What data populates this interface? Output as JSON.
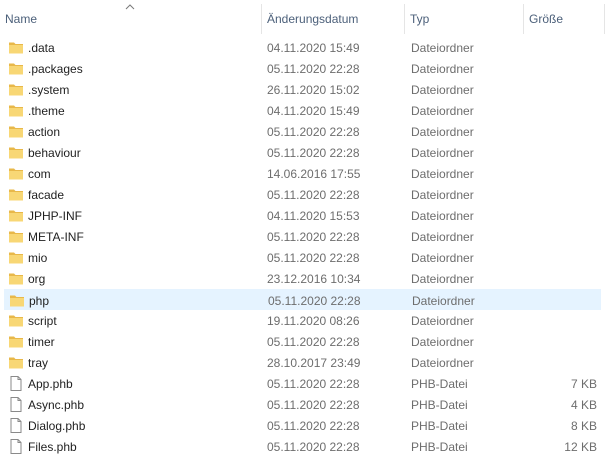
{
  "columns": {
    "name": "Name",
    "date": "Änderungsdatum",
    "type": "Typ",
    "size": "Größe"
  },
  "sort": {
    "column": "name",
    "direction": "ascending"
  },
  "selected_index": 12,
  "items": [
    {
      "name": ".data",
      "date": "04.11.2020 15:49",
      "type": "Dateiordner",
      "size": "",
      "kind": "folder"
    },
    {
      "name": ".packages",
      "date": "05.11.2020 22:28",
      "type": "Dateiordner",
      "size": "",
      "kind": "folder"
    },
    {
      "name": ".system",
      "date": "26.11.2020 15:02",
      "type": "Dateiordner",
      "size": "",
      "kind": "folder"
    },
    {
      "name": ".theme",
      "date": "04.11.2020 15:49",
      "type": "Dateiordner",
      "size": "",
      "kind": "folder"
    },
    {
      "name": "action",
      "date": "05.11.2020 22:28",
      "type": "Dateiordner",
      "size": "",
      "kind": "folder"
    },
    {
      "name": "behaviour",
      "date": "05.11.2020 22:28",
      "type": "Dateiordner",
      "size": "",
      "kind": "folder"
    },
    {
      "name": "com",
      "date": "14.06.2016 17:55",
      "type": "Dateiordner",
      "size": "",
      "kind": "folder"
    },
    {
      "name": "facade",
      "date": "05.11.2020 22:28",
      "type": "Dateiordner",
      "size": "",
      "kind": "folder"
    },
    {
      "name": "JPHP-INF",
      "date": "04.11.2020 15:53",
      "type": "Dateiordner",
      "size": "",
      "kind": "folder"
    },
    {
      "name": "META-INF",
      "date": "05.11.2020 22:28",
      "type": "Dateiordner",
      "size": "",
      "kind": "folder"
    },
    {
      "name": "mio",
      "date": "05.11.2020 22:28",
      "type": "Dateiordner",
      "size": "",
      "kind": "folder"
    },
    {
      "name": "org",
      "date": "23.12.2016 10:34",
      "type": "Dateiordner",
      "size": "",
      "kind": "folder"
    },
    {
      "name": "php",
      "date": "05.11.2020 22:28",
      "type": "Dateiordner",
      "size": "",
      "kind": "folder"
    },
    {
      "name": "script",
      "date": "19.11.2020 08:26",
      "type": "Dateiordner",
      "size": "",
      "kind": "folder"
    },
    {
      "name": "timer",
      "date": "05.11.2020 22:28",
      "type": "Dateiordner",
      "size": "",
      "kind": "folder"
    },
    {
      "name": "tray",
      "date": "28.10.2017 23:49",
      "type": "Dateiordner",
      "size": "",
      "kind": "folder"
    },
    {
      "name": "App.phb",
      "date": "05.11.2020 22:28",
      "type": "PHB-Datei",
      "size": "7 KB",
      "kind": "file"
    },
    {
      "name": "Async.phb",
      "date": "05.11.2020 22:28",
      "type": "PHB-Datei",
      "size": "4 KB",
      "kind": "file"
    },
    {
      "name": "Dialog.phb",
      "date": "05.11.2020 22:28",
      "type": "PHB-Datei",
      "size": "8 KB",
      "kind": "file"
    },
    {
      "name": "Files.phb",
      "date": "05.11.2020 22:28",
      "type": "PHB-Datei",
      "size": "12 KB",
      "kind": "file"
    }
  ],
  "colors": {
    "folder": "#f8d775",
    "folder_dark": "#e8b84a",
    "selection": "#e5f3ff",
    "header_text": "#4c607a",
    "meta_text": "#6d6d6d"
  },
  "icons": {
    "folder": "folder-icon",
    "file": "file-icon",
    "sort": "sort-ascending-icon"
  }
}
